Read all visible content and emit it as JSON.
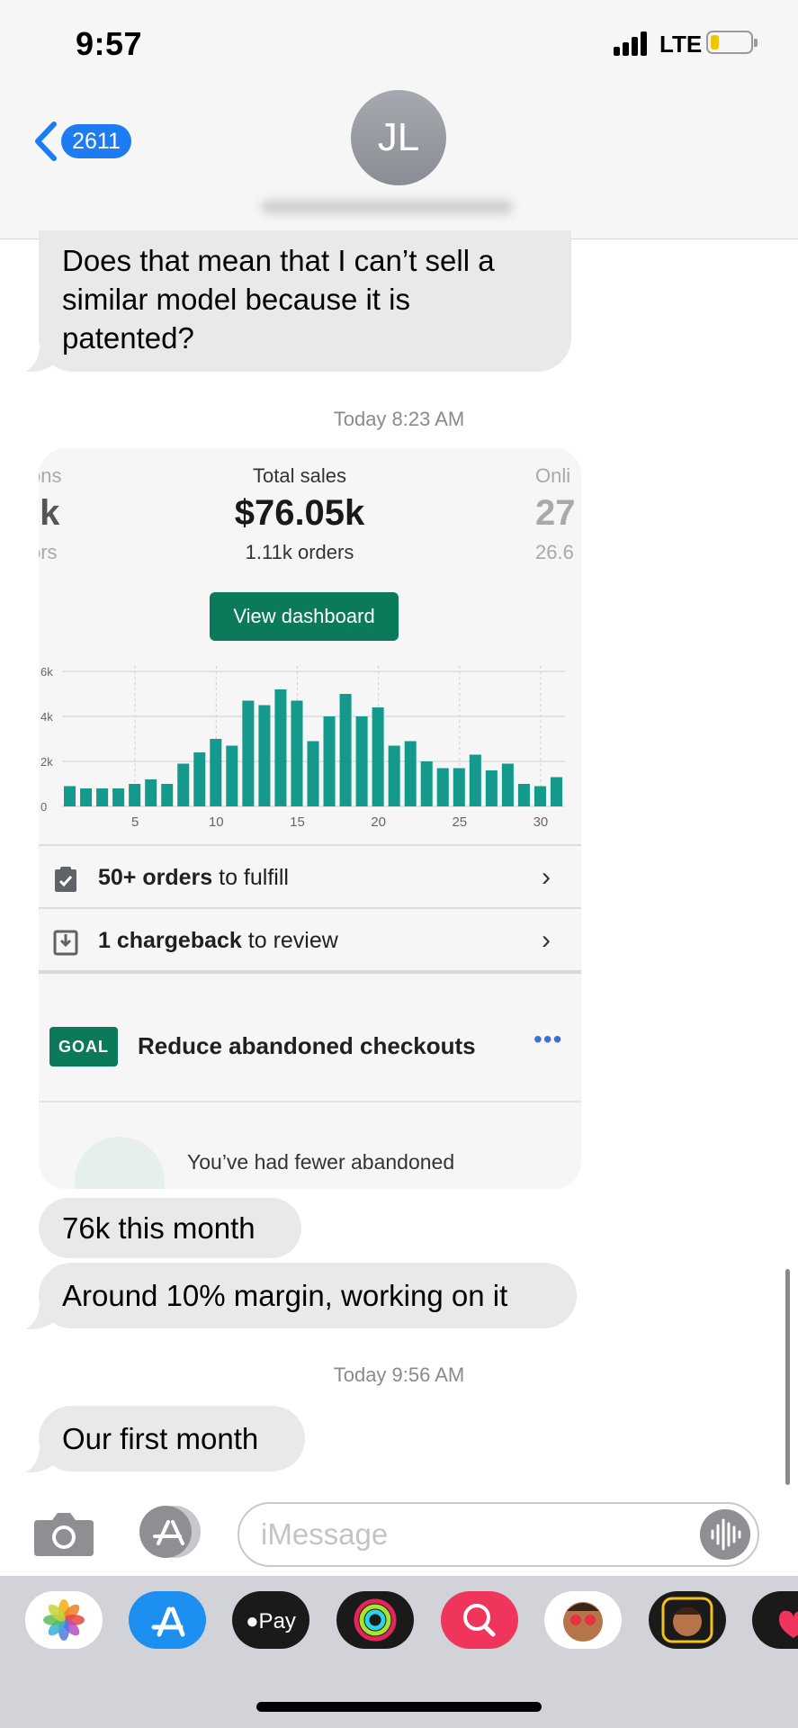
{
  "status_bar": {
    "time": "9:57",
    "network": "LTE",
    "battery_color": "#f5c400"
  },
  "header": {
    "back_count": "2611",
    "avatar_initials": "JL"
  },
  "messages": {
    "m1": [
      "Does that mean that I can’t sell a",
      "similar model because it is",
      "patented?"
    ],
    "timestamp1": "Today 8:23 AM",
    "m2": "76k this month",
    "m3": "Around 10% margin, working on it",
    "timestamp2": "Today 9:56 AM",
    "m4": "Our first month"
  },
  "shared_image": {
    "left_stat": {
      "label": "ons",
      "value": "lk",
      "sub": "ors"
    },
    "center_stat": {
      "label": "Total sales",
      "value": "$76.05k",
      "sub": "1.11k orders"
    },
    "right_stat": {
      "label": "Onli",
      "value": "27",
      "sub": "26.6"
    },
    "dashboard_button": "View dashboard",
    "task1": {
      "bold": "50+ orders",
      "rest": " to fulfill"
    },
    "task2": {
      "bold": "1 chargeback",
      "rest": " to review"
    },
    "goal_badge": "GOAL",
    "goal_title": "Reduce abandoned checkouts",
    "goal_text": "You’ve had fewer abandoned",
    "accent_color": "#0b7a5a",
    "bar_color": "#149a8c"
  },
  "chart_data": {
    "type": "bar",
    "x": [
      1,
      2,
      3,
      4,
      5,
      6,
      7,
      8,
      9,
      10,
      11,
      12,
      13,
      14,
      15,
      16,
      17,
      18,
      19,
      20,
      21,
      22,
      23,
      24,
      25,
      26,
      27,
      28,
      29,
      30,
      31
    ],
    "values": [
      900,
      800,
      800,
      800,
      1000,
      1200,
      1000,
      1900,
      2400,
      3000,
      2700,
      4700,
      4500,
      5200,
      4700,
      2900,
      4000,
      5000,
      4000,
      4400,
      2700,
      2900,
      2000,
      1700,
      1700,
      2300,
      1600,
      1900,
      1000,
      900,
      1300
    ],
    "yticks": [
      "0",
      "2k",
      "4k",
      "6k"
    ],
    "xticks": [
      "5",
      "10",
      "15",
      "20",
      "25",
      "30"
    ],
    "ylim": [
      0,
      6000
    ],
    "grid": true
  },
  "composer": {
    "placeholder": "iMessage"
  },
  "app_drawer": [
    "photos-app",
    "app-store-app",
    "apple-pay-app",
    "fitness-app",
    "web-search-app",
    "memoji-app",
    "animoji-app",
    "digital-touch-app"
  ]
}
